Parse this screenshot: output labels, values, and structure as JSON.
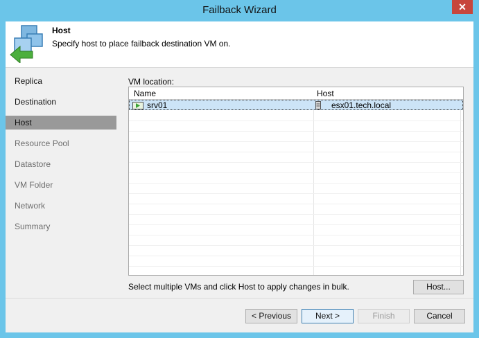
{
  "window": {
    "title": "Failback Wizard",
    "close_glyph": "✕"
  },
  "header": {
    "title": "Host",
    "subtitle": "Specify host to place failback destination VM on.",
    "icon": "failback-wizard-icon"
  },
  "sidebar": {
    "items": [
      {
        "label": "Replica",
        "state": "normal"
      },
      {
        "label": "Destination",
        "state": "normal"
      },
      {
        "label": "Host",
        "state": "active"
      },
      {
        "label": "Resource Pool",
        "state": "disabled"
      },
      {
        "label": "Datastore",
        "state": "disabled"
      },
      {
        "label": "VM Folder",
        "state": "disabled"
      },
      {
        "label": "Network",
        "state": "disabled"
      },
      {
        "label": "Summary",
        "state": "disabled"
      }
    ]
  },
  "main": {
    "vm_location_label": "VM location:",
    "columns": [
      "Name",
      "Host"
    ],
    "rows": [
      {
        "name": "srv01",
        "host": "esx01.tech.local",
        "icon": "vm-icon",
        "host_icon": "server-icon",
        "selected": true
      }
    ],
    "bulk_hint": "Select multiple VMs and click Host to apply changes in bulk.",
    "host_button": "Host..."
  },
  "footer": {
    "previous": "< Previous",
    "next": "Next >",
    "finish": "Finish",
    "cancel": "Cancel"
  },
  "colors": {
    "title_bar": "#6bc5e9",
    "active_nav": "#999999",
    "close_button": "#c7463c",
    "selection": "#cce4f7"
  }
}
